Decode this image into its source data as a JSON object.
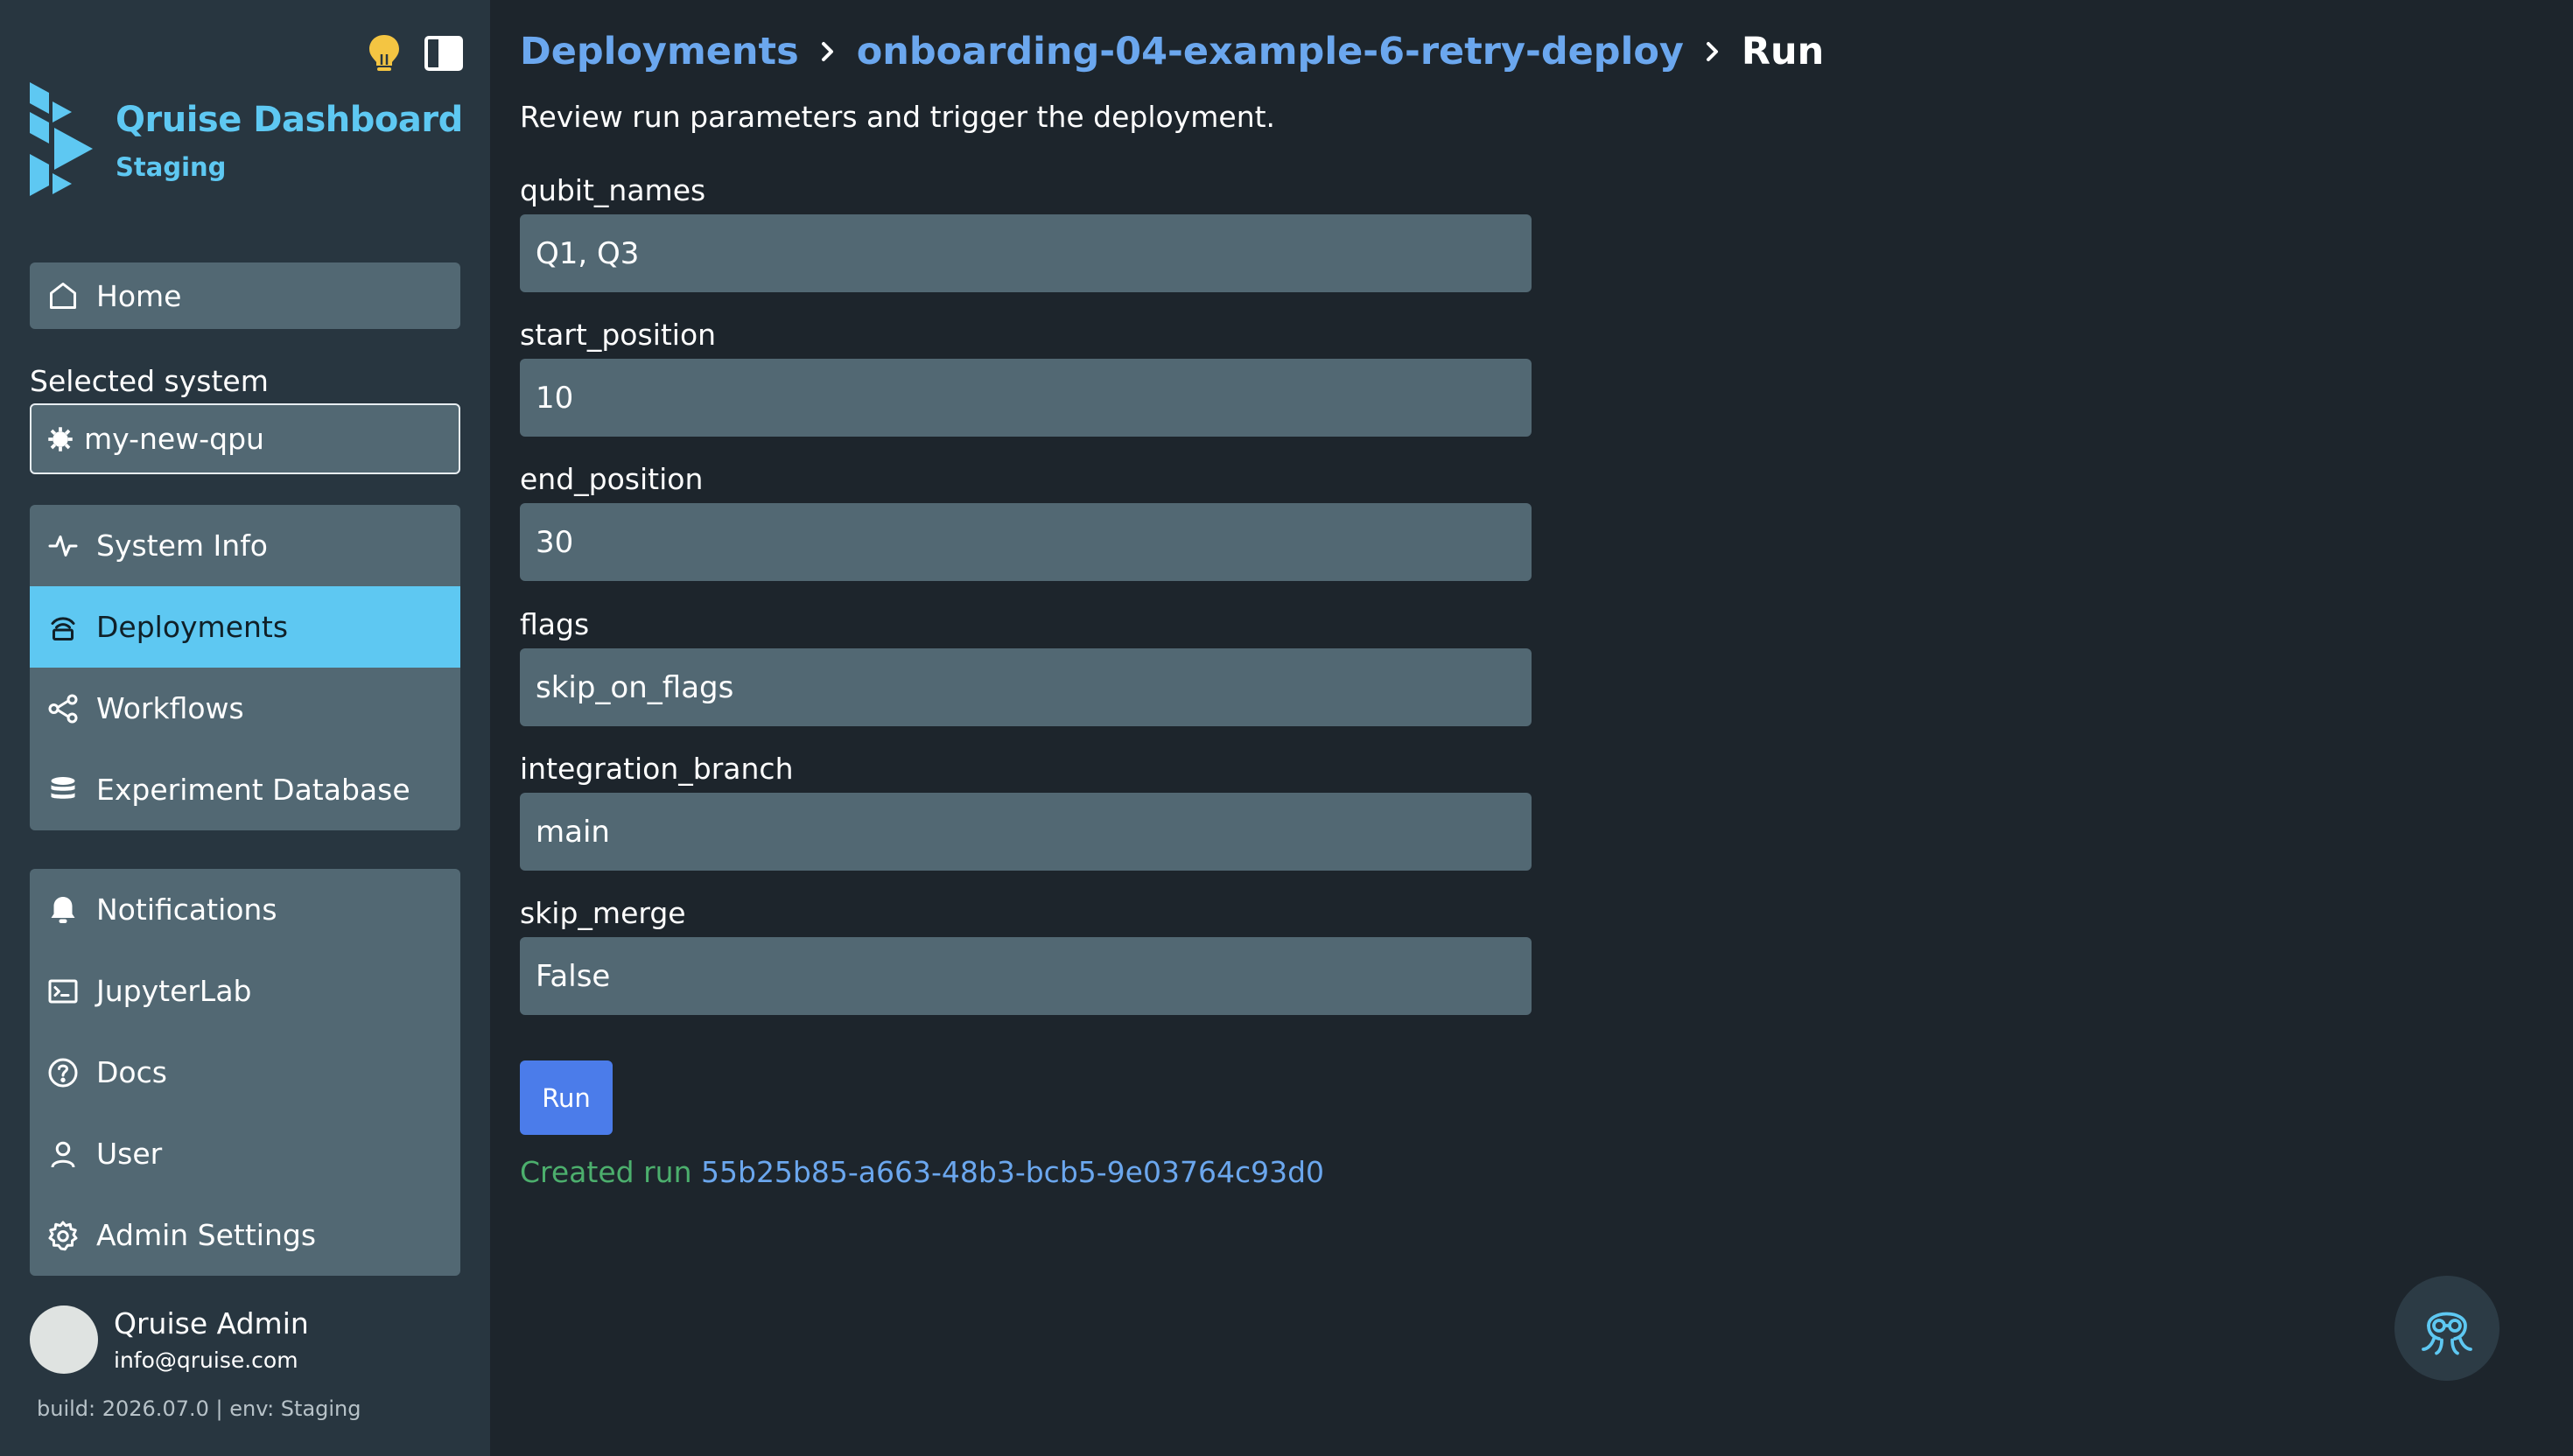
{
  "app": {
    "title": "Qruise Dashboard",
    "environment_badge": "Staging"
  },
  "sidebar": {
    "home_label": "Home",
    "selected_system_label": "Selected system",
    "selected_system_value": "my-new-qpu",
    "main_items": [
      {
        "label": "System Info",
        "icon": "activity-icon"
      },
      {
        "label": "Deployments",
        "icon": "deployments-icon",
        "active": true
      },
      {
        "label": "Workflows",
        "icon": "workflow-icon"
      },
      {
        "label": "Experiment Database",
        "icon": "database-icon"
      }
    ],
    "util_items": [
      {
        "label": "Notifications",
        "icon": "bell-icon"
      },
      {
        "label": "JupyterLab",
        "icon": "terminal-icon"
      },
      {
        "label": "Docs",
        "icon": "help-circle-icon"
      },
      {
        "label": "User",
        "icon": "user-icon"
      },
      {
        "label": "Admin Settings",
        "icon": "settings-icon"
      }
    ],
    "user": {
      "name": "Qruise Admin",
      "email": "info@qruise.com"
    },
    "build_info": "build: 2026.07.0 | env: Staging"
  },
  "breadcrumb": {
    "root": "Deployments",
    "deployment": "onboarding-04-example-6-retry-deploy",
    "current": "Run"
  },
  "main": {
    "subtitle": "Review run parameters and trigger the deployment.",
    "fields": [
      {
        "label": "qubit_names",
        "value": "Q1, Q3"
      },
      {
        "label": "start_position",
        "value": "10"
      },
      {
        "label": "end_position",
        "value": "30"
      },
      {
        "label": "flags",
        "value": "skip_on_flags"
      },
      {
        "label": "integration_branch",
        "value": "main"
      },
      {
        "label": "skip_merge",
        "value": "False"
      }
    ],
    "run_button_label": "Run",
    "result_prefix": "Created run",
    "result_run_id": "55b25b85-a663-48b3-bcb5-9e03764c93d0"
  },
  "colors": {
    "accent": "#5ec8f2",
    "link": "#6ba7ee",
    "success": "#4caf6d",
    "button": "#4b7cea",
    "sidebar_bg": "#283640",
    "page_bg": "#1d252c",
    "input_bg": "#526873",
    "tip_icon": "#f4c542"
  },
  "icons": {
    "tip": "lightbulb-icon",
    "sidebar_toggle": "sidebar-toggle-icon",
    "assistant": "octopus-assistant-icon"
  }
}
